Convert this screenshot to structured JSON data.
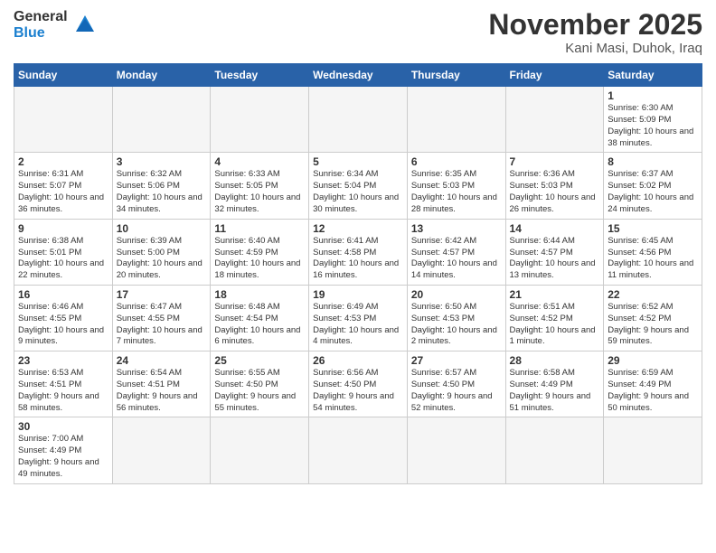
{
  "header": {
    "logo_general": "General",
    "logo_blue": "Blue",
    "month_year": "November 2025",
    "location": "Kani Masi, Duhok, Iraq"
  },
  "days_of_week": [
    "Sunday",
    "Monday",
    "Tuesday",
    "Wednesday",
    "Thursday",
    "Friday",
    "Saturday"
  ],
  "weeks": [
    [
      {
        "day": "",
        "info": ""
      },
      {
        "day": "",
        "info": ""
      },
      {
        "day": "",
        "info": ""
      },
      {
        "day": "",
        "info": ""
      },
      {
        "day": "",
        "info": ""
      },
      {
        "day": "",
        "info": ""
      },
      {
        "day": "1",
        "info": "Sunrise: 6:30 AM\nSunset: 5:09 PM\nDaylight: 10 hours and 38 minutes."
      }
    ],
    [
      {
        "day": "2",
        "info": "Sunrise: 6:31 AM\nSunset: 5:07 PM\nDaylight: 10 hours and 36 minutes."
      },
      {
        "day": "3",
        "info": "Sunrise: 6:32 AM\nSunset: 5:06 PM\nDaylight: 10 hours and 34 minutes."
      },
      {
        "day": "4",
        "info": "Sunrise: 6:33 AM\nSunset: 5:05 PM\nDaylight: 10 hours and 32 minutes."
      },
      {
        "day": "5",
        "info": "Sunrise: 6:34 AM\nSunset: 5:04 PM\nDaylight: 10 hours and 30 minutes."
      },
      {
        "day": "6",
        "info": "Sunrise: 6:35 AM\nSunset: 5:03 PM\nDaylight: 10 hours and 28 minutes."
      },
      {
        "day": "7",
        "info": "Sunrise: 6:36 AM\nSunset: 5:03 PM\nDaylight: 10 hours and 26 minutes."
      },
      {
        "day": "8",
        "info": "Sunrise: 6:37 AM\nSunset: 5:02 PM\nDaylight: 10 hours and 24 minutes."
      }
    ],
    [
      {
        "day": "9",
        "info": "Sunrise: 6:38 AM\nSunset: 5:01 PM\nDaylight: 10 hours and 22 minutes."
      },
      {
        "day": "10",
        "info": "Sunrise: 6:39 AM\nSunset: 5:00 PM\nDaylight: 10 hours and 20 minutes."
      },
      {
        "day": "11",
        "info": "Sunrise: 6:40 AM\nSunset: 4:59 PM\nDaylight: 10 hours and 18 minutes."
      },
      {
        "day": "12",
        "info": "Sunrise: 6:41 AM\nSunset: 4:58 PM\nDaylight: 10 hours and 16 minutes."
      },
      {
        "day": "13",
        "info": "Sunrise: 6:42 AM\nSunset: 4:57 PM\nDaylight: 10 hours and 14 minutes."
      },
      {
        "day": "14",
        "info": "Sunrise: 6:44 AM\nSunset: 4:57 PM\nDaylight: 10 hours and 13 minutes."
      },
      {
        "day": "15",
        "info": "Sunrise: 6:45 AM\nSunset: 4:56 PM\nDaylight: 10 hours and 11 minutes."
      }
    ],
    [
      {
        "day": "16",
        "info": "Sunrise: 6:46 AM\nSunset: 4:55 PM\nDaylight: 10 hours and 9 minutes."
      },
      {
        "day": "17",
        "info": "Sunrise: 6:47 AM\nSunset: 4:55 PM\nDaylight: 10 hours and 7 minutes."
      },
      {
        "day": "18",
        "info": "Sunrise: 6:48 AM\nSunset: 4:54 PM\nDaylight: 10 hours and 6 minutes."
      },
      {
        "day": "19",
        "info": "Sunrise: 6:49 AM\nSunset: 4:53 PM\nDaylight: 10 hours and 4 minutes."
      },
      {
        "day": "20",
        "info": "Sunrise: 6:50 AM\nSunset: 4:53 PM\nDaylight: 10 hours and 2 minutes."
      },
      {
        "day": "21",
        "info": "Sunrise: 6:51 AM\nSunset: 4:52 PM\nDaylight: 10 hours and 1 minute."
      },
      {
        "day": "22",
        "info": "Sunrise: 6:52 AM\nSunset: 4:52 PM\nDaylight: 9 hours and 59 minutes."
      }
    ],
    [
      {
        "day": "23",
        "info": "Sunrise: 6:53 AM\nSunset: 4:51 PM\nDaylight: 9 hours and 58 minutes."
      },
      {
        "day": "24",
        "info": "Sunrise: 6:54 AM\nSunset: 4:51 PM\nDaylight: 9 hours and 56 minutes."
      },
      {
        "day": "25",
        "info": "Sunrise: 6:55 AM\nSunset: 4:50 PM\nDaylight: 9 hours and 55 minutes."
      },
      {
        "day": "26",
        "info": "Sunrise: 6:56 AM\nSunset: 4:50 PM\nDaylight: 9 hours and 54 minutes."
      },
      {
        "day": "27",
        "info": "Sunrise: 6:57 AM\nSunset: 4:50 PM\nDaylight: 9 hours and 52 minutes."
      },
      {
        "day": "28",
        "info": "Sunrise: 6:58 AM\nSunset: 4:49 PM\nDaylight: 9 hours and 51 minutes."
      },
      {
        "day": "29",
        "info": "Sunrise: 6:59 AM\nSunset: 4:49 PM\nDaylight: 9 hours and 50 minutes."
      }
    ],
    [
      {
        "day": "30",
        "info": "Sunrise: 7:00 AM\nSunset: 4:49 PM\nDaylight: 9 hours and 49 minutes."
      },
      {
        "day": "",
        "info": ""
      },
      {
        "day": "",
        "info": ""
      },
      {
        "day": "",
        "info": ""
      },
      {
        "day": "",
        "info": ""
      },
      {
        "day": "",
        "info": ""
      },
      {
        "day": "",
        "info": ""
      }
    ]
  ]
}
